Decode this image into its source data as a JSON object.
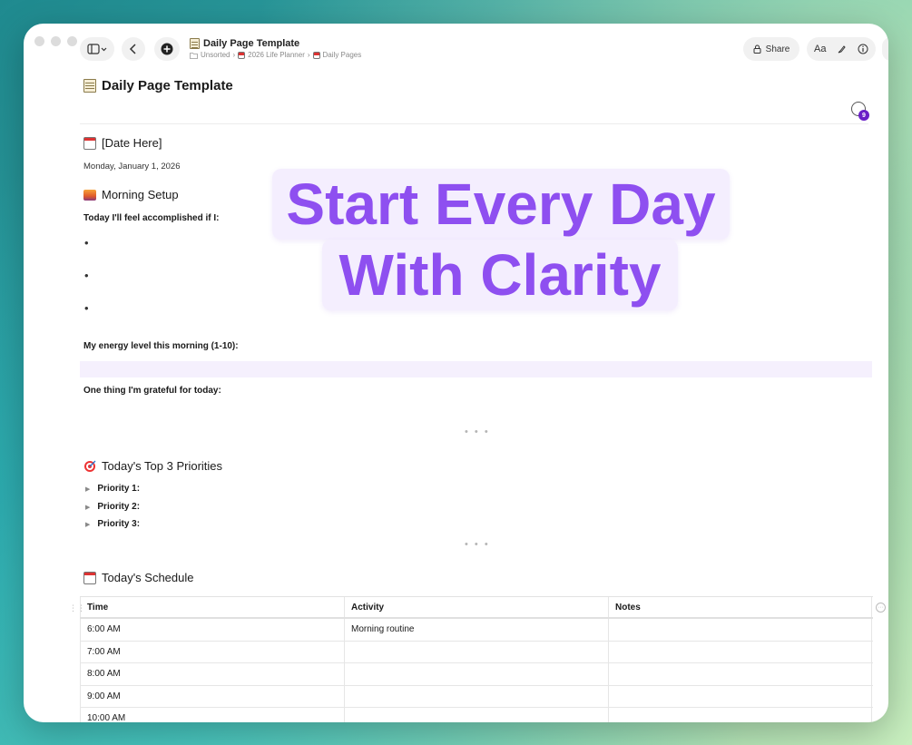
{
  "toolbar": {
    "share_label": "Share",
    "font_label": "Aa"
  },
  "breadcrumb": {
    "title": "Daily Page Template",
    "path": [
      "Unsorted",
      "2026 Life Planner",
      "Daily Pages"
    ]
  },
  "document": {
    "title": "Daily Page Template",
    "comment_count": "9",
    "date_heading": "[Date Here]",
    "date_text": "Monday, January 1, 2026",
    "morning_heading": "Morning Setup",
    "accomplished_label": "Today I'll feel accomplished if I:",
    "bullets": [
      "•",
      "•",
      "•"
    ],
    "energy_label": "My energy level this morning (1-10):",
    "grateful_label": "One thing I'm grateful for today:",
    "dots": "• • •",
    "priorities_heading": "Today's Top 3 Priorities",
    "priorities": [
      "Priority 1:",
      "Priority 2:",
      "Priority 3:"
    ],
    "schedule_heading": "Today's Schedule"
  },
  "schedule_table": {
    "headers": [
      "Time",
      "Activity",
      "Notes"
    ],
    "rows": [
      [
        "6:00 AM",
        "Morning routine",
        ""
      ],
      [
        "7:00 AM",
        "",
        ""
      ],
      [
        "8:00 AM",
        "",
        ""
      ],
      [
        "9:00 AM",
        "",
        ""
      ],
      [
        "10:00 AM",
        "",
        ""
      ]
    ]
  },
  "overlay": {
    "line1": "Start Every Day",
    "line2": "With Clarity"
  },
  "colors": {
    "accent_purple": "#8e4ff0",
    "badge_purple": "#6a1fc7"
  }
}
